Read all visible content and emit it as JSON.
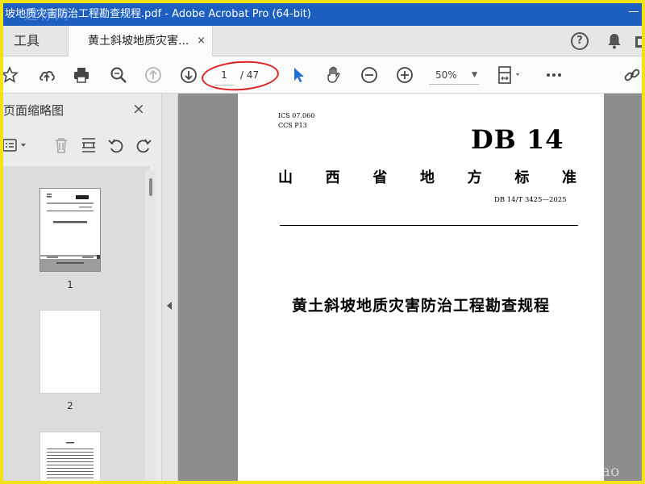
{
  "window": {
    "title": "坡地质灾害防治工程勘查规程.pdf - Adobe Acrobat Pro (64-bit)",
    "watermark_top": "速标网"
  },
  "tabs": {
    "tools_label": "工具",
    "document_label": "黄土斜坡地质灾害...",
    "close_glyph": "×"
  },
  "toolbar": {
    "current_page": "1",
    "total_pages": "/ 47",
    "zoom": "50%"
  },
  "panel": {
    "title": "页面缩略图",
    "close_glyph": "×",
    "thumbnails": [
      {
        "label": "1"
      },
      {
        "label": "2"
      }
    ]
  },
  "page": {
    "ics": "ICS  07.060",
    "ccs": "CCS  P13",
    "standard_mark": "DB 14",
    "province": "山 西 省 地 方 标 准",
    "code": "DB 14/T  3425—2025",
    "doc_title": "黄土斜坡地质灾害防治工程勘查规程"
  },
  "watermark_bottom": "www.cndao",
  "colors": {
    "titlebar": "#1d5fc1",
    "frame": "#f2e315",
    "highlight_circle": "#e02020",
    "select_arrow": "#1e6fd9"
  }
}
